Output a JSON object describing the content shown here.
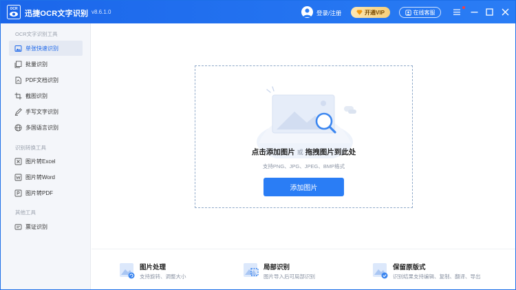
{
  "app": {
    "title": "迅捷OCR文字识别",
    "version": "v8.6.1.0",
    "logo_text": "OCR"
  },
  "header": {
    "login_label": "登录/注册",
    "vip_label": "开通VIP",
    "service_label": "在线客服"
  },
  "sidebar": {
    "sections": [
      {
        "title": "OCR文字识别工具",
        "items": [
          {
            "label": "单张快速识别",
            "icon": "single-image-icon",
            "active": true
          },
          {
            "label": "批量识别",
            "icon": "batch-icon"
          },
          {
            "label": "PDF文档识别",
            "icon": "pdf-document-icon"
          },
          {
            "label": "截图识别",
            "icon": "screenshot-icon"
          },
          {
            "label": "手写文字识别",
            "icon": "handwriting-icon"
          },
          {
            "label": "多国语言识别",
            "icon": "globe-icon"
          }
        ]
      },
      {
        "title": "识别转换工具",
        "items": [
          {
            "label": "图片转Excel",
            "icon": "excel-icon"
          },
          {
            "label": "图片转Word",
            "icon": "word-icon"
          },
          {
            "label": "图片转PDF",
            "icon": "pdf-icon"
          }
        ]
      },
      {
        "title": "其他工具",
        "items": [
          {
            "label": "票证识别",
            "icon": "ticket-icon"
          }
        ]
      }
    ]
  },
  "main": {
    "drop_title_a": "点击添加图片",
    "drop_or": "或",
    "drop_title_b": "拖拽图片到此处",
    "drop_hint": "支持PNG、JPG、JPEG、BMP格式",
    "add_button": "添加图片"
  },
  "features": [
    {
      "title": "图片处理",
      "desc": "支持旋转、调整大小",
      "icon": "image-process-icon"
    },
    {
      "title": "局部识别",
      "desc": "图片导入后可局部识别",
      "icon": "partial-recognition-icon"
    },
    {
      "title": "保留原版式",
      "desc": "识别结果支持编辑、复制、翻译、导出",
      "icon": "keep-layout-icon"
    }
  ],
  "colors": {
    "brand_blue": "#1b66ea",
    "button_blue": "#2a7df5",
    "vip_gold": "#f7cf7a"
  }
}
